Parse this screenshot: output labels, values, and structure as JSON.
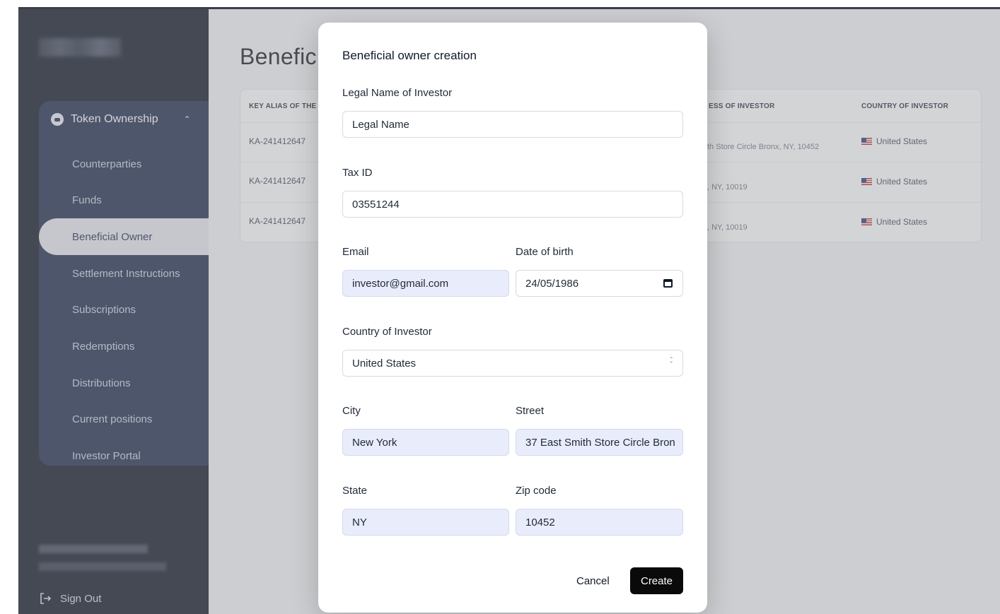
{
  "sidebar": {
    "group_label": "Token Ownership",
    "items": [
      {
        "label": "Counterparties"
      },
      {
        "label": "Funds"
      },
      {
        "label": "Beneficial Owner"
      },
      {
        "label": "Settlement Instructions"
      },
      {
        "label": "Subscriptions"
      },
      {
        "label": "Redemptions"
      },
      {
        "label": "Distributions"
      },
      {
        "label": "Current positions"
      },
      {
        "label": "Investor Portal"
      }
    ],
    "sign_out": "Sign Out"
  },
  "page": {
    "title": "Benefic",
    "table": {
      "headers": [
        "KEY ALIAS OF THE",
        "ESS OF INVESTOR",
        "COUNTRY OF INVESTOR"
      ],
      "rows": [
        {
          "key": "KA-241412647",
          "address": "th Store Circle Bronx, NY, 10452",
          "country": "United States"
        },
        {
          "key": "KA-241412647",
          "address": ", NY, 10019",
          "country": "United States"
        },
        {
          "key": "KA-241412647",
          "address": ", NY, 10019",
          "country": "United States"
        }
      ]
    }
  },
  "modal": {
    "title": "Beneficial owner creation",
    "fields": {
      "legal_name": {
        "label": "Legal Name of Investor",
        "value": "Legal Name"
      },
      "tax_id": {
        "label": "Tax ID",
        "value": "03551244"
      },
      "email": {
        "label": "Email",
        "value": "investor@gmail.com"
      },
      "dob": {
        "label": "Date of birth",
        "value": "24/05/1986"
      },
      "country": {
        "label": "Country of Investor",
        "value": "United States"
      },
      "city": {
        "label": "City",
        "value": "New York"
      },
      "street": {
        "label": "Street",
        "value": "37 East Smith Store Circle Bron"
      },
      "state": {
        "label": "State",
        "value": "NY"
      },
      "zip": {
        "label": "Zip code",
        "value": "10452"
      }
    },
    "cancel_label": "Cancel",
    "create_label": "Create"
  },
  "icons": {
    "group": "token-icon",
    "chevron": "chevron-up-icon",
    "calendar": "calendar-icon",
    "select": "select-arrows-icon",
    "signout": "sign-out-icon"
  },
  "colors": {
    "sidebar_bg": "#0b1120",
    "nav_panel_bg": "#1a2647",
    "primary_button": "#0a0a0a",
    "filled_input": "#e9edfb"
  }
}
